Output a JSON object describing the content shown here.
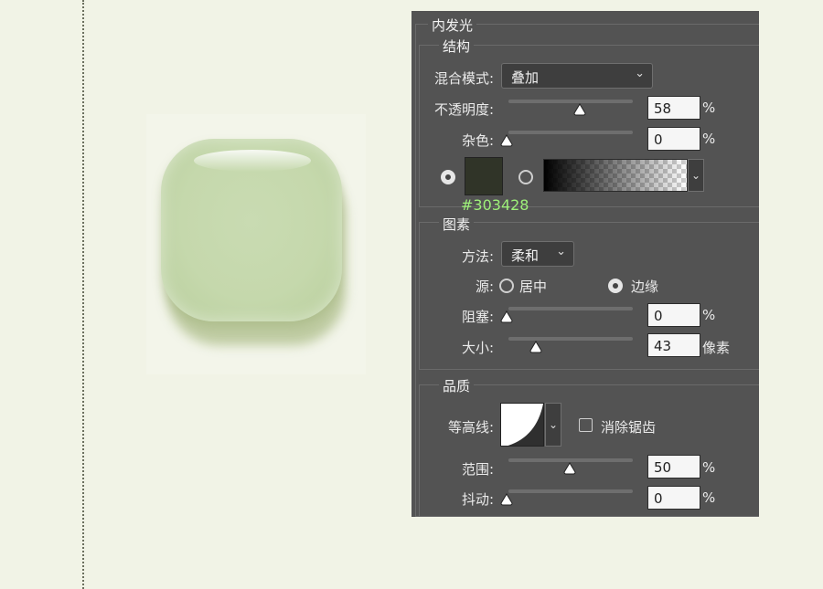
{
  "panel": {
    "title": "内发光",
    "structure": {
      "heading": "结构",
      "blend_mode_label": "混合模式:",
      "blend_mode_value": "叠加",
      "opacity_label": "不透明度:",
      "opacity_value": "58",
      "opacity_unit": "%",
      "noise_label": "杂色:",
      "noise_value": "0",
      "noise_unit": "%",
      "color_hex": "#303428"
    },
    "elements": {
      "heading": "图素",
      "method_label": "方法:",
      "method_value": "柔和",
      "source_label": "源:",
      "source_center": "居中",
      "source_edge": "边缘",
      "choke_label": "阻塞:",
      "choke_value": "0",
      "choke_unit": "%",
      "size_label": "大小:",
      "size_value": "43",
      "size_unit": "像素"
    },
    "quality": {
      "heading": "品质",
      "contour_label": "等高线:",
      "antialias_label": "消除锯齿",
      "range_label": "范围:",
      "range_value": "50",
      "range_unit": "%",
      "jitter_label": "抖动:",
      "jitter_value": "0",
      "jitter_unit": "%"
    }
  },
  "icons": {
    "dropdown": "chevron-down-icon",
    "slider_thumb": "slider-thumb-icon",
    "radio": "radio-icon"
  },
  "colors": {
    "page_bg": "#f1f3e6",
    "panel_bg": "#535353",
    "glow_color": "#303428",
    "hex_text": "#9ef07a",
    "icon_fill": "#c5d8ac"
  }
}
